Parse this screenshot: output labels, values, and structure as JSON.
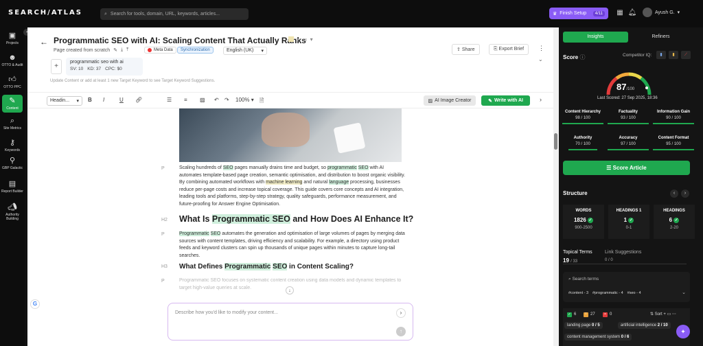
{
  "topbar": {
    "logo": "SEARCH/ATLAS",
    "search_placeholder": "Search for tools, domain, URL, keywords, articles...",
    "finish_setup": "Finish Setup",
    "finish_count": "4/11",
    "user": "Ayush G."
  },
  "nav": [
    {
      "label": "Projects",
      "icon": "grid-icon"
    },
    {
      "label": "OTTO & Audit",
      "icon": "bot-icon"
    },
    {
      "label": "OTTO PPC",
      "icon": "thumb-icon"
    },
    {
      "label": "Content",
      "icon": "pen-icon"
    },
    {
      "label": "Site Metrics",
      "icon": "magnify-icon"
    },
    {
      "label": "Keywords",
      "icon": "key-icon"
    },
    {
      "label": "GBP Galactic",
      "icon": "pin-icon"
    },
    {
      "label": "Report Builder",
      "icon": "report-icon"
    },
    {
      "label": "Authority Building",
      "icon": "megaphone-icon"
    }
  ],
  "doc": {
    "title": "Programmatic SEO with AI: Scaling Content That Actually Ranks",
    "created": "Page created from scratch",
    "meta": "Meta Data",
    "sync": "Synchronization",
    "language": "English (UK)",
    "share": "Share",
    "export": "Export Brief",
    "keyword": "programmatic seo with ai",
    "sv": "SV: 10",
    "kd": "KD: 37",
    "cpc": "CPC: $0",
    "hint": "Update Content or add at least 1 new Target Keyword to see Target Keyword Suggestions."
  },
  "toolbar": {
    "heading": "Headin...",
    "zoom": "100%",
    "ai_image": "AI Image Creator",
    "write_ai": "Write with AI"
  },
  "content": {
    "tag_p": "P",
    "tag_h2": "H2",
    "tag_h3": "H3",
    "h2": "What Is Programmatic SEO and How Does AI Enhance It?",
    "h3": "What Defines Programmatic SEO in Content Scaling?",
    "faded": "Programmatic SEO focuses on systematic content creation using data models and dynamic templates to target high-value queries at scale.",
    "prompt_placeholder": "Describe how you'd like to modify your content..."
  },
  "insights": {
    "tab_insights": "Insights",
    "tab_refiners": "Refiners",
    "score_label": "Score",
    "competitor": "Competitor IQ:",
    "score": "87",
    "score_max": "/100",
    "last_scored": "Last Scored: 27 Sep 2025, 18:36",
    "metrics": [
      {
        "name": "Content Hierarchy",
        "value": "98 / 100"
      },
      {
        "name": "Factuality",
        "value": "93 / 100"
      },
      {
        "name": "Information Gain",
        "value": "90 / 100"
      },
      {
        "name": "Authority",
        "value": "70 / 100"
      },
      {
        "name": "Accuracy",
        "value": "97 / 100"
      },
      {
        "name": "Content Format",
        "value": "95 / 100"
      }
    ],
    "score_btn": "Score Article",
    "structure": "Structure",
    "struct": [
      {
        "label": "WORDS",
        "value": "1826",
        "range": "900-2500"
      },
      {
        "label": "HEADINGS 1",
        "value": "1",
        "range": "0-1"
      },
      {
        "label": "HEADINGS",
        "value": "6",
        "range": "2-20"
      }
    ],
    "topical": "Topical Terms",
    "topical_count": "19",
    "topical_total": "/ 33",
    "link": "Link Suggestions",
    "link_count": "0 / 0",
    "search_terms": "Search terms",
    "chips": [
      "#content - 3",
      "#programmatic - 4",
      "#seo - 4"
    ],
    "filter_green": "6",
    "filter_yellow": "27",
    "filter_red": "0",
    "sort": "Sort",
    "terms": [
      {
        "name": "landing page",
        "count": "0 / 5"
      },
      {
        "name": "artificial intelligence",
        "count": "2 / 10"
      },
      {
        "name": "content management system",
        "count": "0 / 6"
      }
    ]
  }
}
